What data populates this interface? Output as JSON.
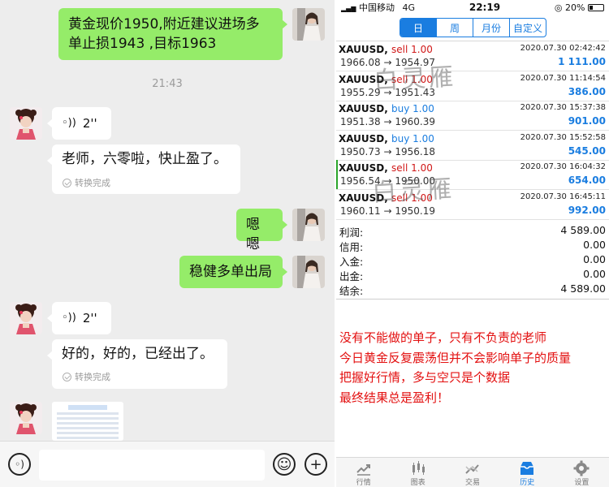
{
  "chat": {
    "messages": [
      {
        "side": "right",
        "type": "text",
        "text": "黄金现价1950,附近建议进场多单止损1943 ,目标1963"
      },
      {
        "side": "left",
        "type": "voice",
        "duration": "2''",
        "transcript": "老师，六零啦，快止盈了。",
        "status": "转换完成"
      },
      {
        "side": "right",
        "type": "text",
        "text": "嗯嗯"
      },
      {
        "side": "right",
        "type": "text",
        "text": "稳健多单出局"
      },
      {
        "side": "left",
        "type": "voice",
        "duration": "2''",
        "transcript": "好的，好的，已经出了。",
        "status": "转换完成"
      },
      {
        "side": "left",
        "type": "image"
      }
    ],
    "timestamp": "21:43",
    "input": {
      "value": "",
      "voice_icon": "voice-input-icon",
      "emoji_icon": "emoji-icon",
      "plus_icon": "plus-icon"
    }
  },
  "mt5": {
    "status_bar": {
      "carrier": "中国移动",
      "network": "4G",
      "time": "22:19",
      "battery": "20%"
    },
    "period_tabs": [
      "日",
      "周",
      "月份",
      "自定义"
    ],
    "active_tab": "日",
    "trades": [
      {
        "symbol": "XAUUSD,",
        "side": "sell",
        "volume": "1.00",
        "open": "1966.08",
        "close": "1954.97",
        "time": "2020.07.30 02:42:42",
        "profit": "1 111.00"
      },
      {
        "symbol": "XAUUSD,",
        "side": "sell",
        "volume": "1.00",
        "open": "1955.29",
        "close": "1951.43",
        "time": "2020.07.30 11:14:54",
        "profit": "386.00"
      },
      {
        "symbol": "XAUUSD,",
        "side": "buy",
        "volume": "1.00",
        "open": "1951.38",
        "close": "1960.39",
        "time": "2020.07.30 15:37:38",
        "profit": "901.00"
      },
      {
        "symbol": "XAUUSD,",
        "side": "buy",
        "volume": "1.00",
        "open": "1950.73",
        "close": "1956.18",
        "time": "2020.07.30 15:52:58",
        "profit": "545.00"
      },
      {
        "symbol": "XAUUSD,",
        "side": "sell",
        "volume": "1.00",
        "open": "1956.54",
        "close": "1950.00",
        "time": "2020.07.30 16:04:32",
        "profit": "654.00"
      },
      {
        "symbol": "XAUUSD,",
        "side": "sell",
        "volume": "1.00",
        "open": "1960.11",
        "close": "1950.19",
        "time": "2020.07.30 16:45:11",
        "profit": "992.00"
      }
    ],
    "arrow": "→",
    "watermark": "白灵雁",
    "summary": [
      {
        "label": "利润:",
        "value": "4 589.00"
      },
      {
        "label": "信用:",
        "value": "0.00"
      },
      {
        "label": "入金:",
        "value": "0.00"
      },
      {
        "label": "出金:",
        "value": "0.00"
      },
      {
        "label": "结余:",
        "value": "4 589.00"
      }
    ],
    "overlay_text": [
      "没有不能做的单子，只有不负责的老师",
      "今日黄金反复震荡但并不会影响单子的质量",
      "把握好行情，多与空只是个数据",
      "最终结果总是盈利！"
    ],
    "overlay_color": "#e31010",
    "bottom_tabs": [
      {
        "label": "行情",
        "icon": "quotes-icon"
      },
      {
        "label": "图表",
        "icon": "chart-icon"
      },
      {
        "label": "交易",
        "icon": "trade-icon"
      },
      {
        "label": "历史",
        "icon": "history-icon",
        "active": true
      },
      {
        "label": "设置",
        "icon": "settings-icon"
      }
    ],
    "accent_color": "#1a7de0"
  }
}
